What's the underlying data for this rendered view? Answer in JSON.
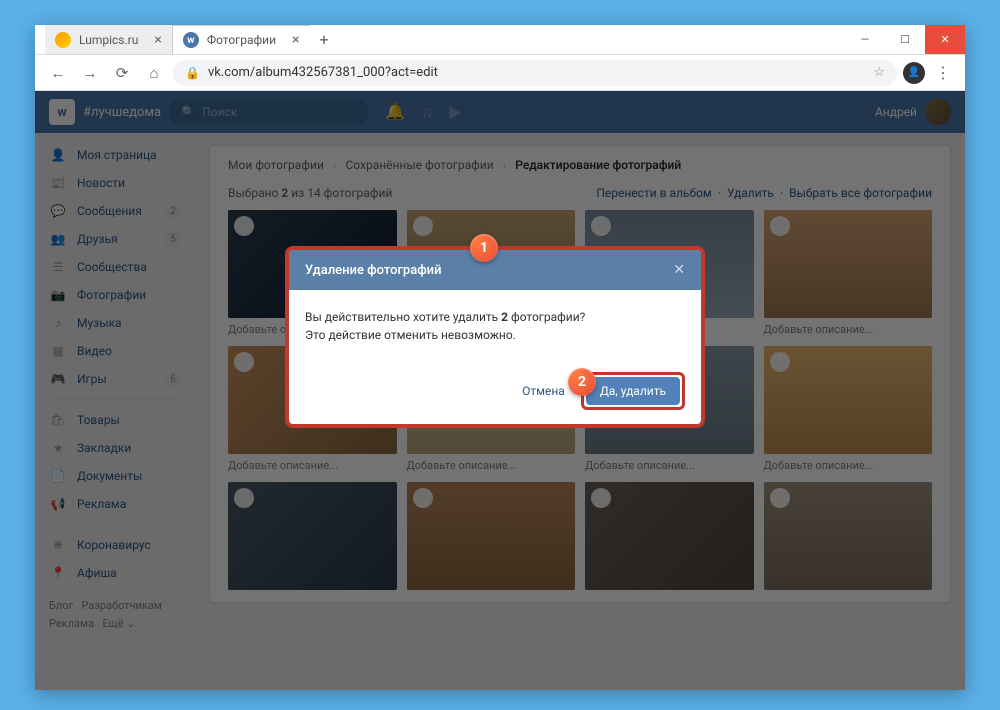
{
  "window": {
    "tabs": [
      {
        "title": "Lumpics.ru"
      },
      {
        "title": "Фотографии"
      }
    ],
    "newtab": "+",
    "controls": {
      "min": "—",
      "max": "☐",
      "close": "✕"
    }
  },
  "addr": {
    "back": "←",
    "fwd": "→",
    "reload": "⟳",
    "home": "⌂",
    "lock": "🔒",
    "url": "vk.com/album432567381_000?act=edit",
    "star": "☆",
    "menu": "⋮"
  },
  "vk": {
    "logo": "w",
    "hashtag": "#лучшедома",
    "search": "Поиск",
    "icons": {
      "bell": "🔔",
      "music": "♫",
      "video": "▶"
    },
    "user": "Андрей"
  },
  "nav": [
    {
      "icon": "👤",
      "label": "Моя страница",
      "badge": null
    },
    {
      "icon": "📰",
      "label": "Новости",
      "badge": null
    },
    {
      "icon": "💬",
      "label": "Сообщения",
      "badge": "2"
    },
    {
      "icon": "👥",
      "label": "Друзья",
      "badge": "5"
    },
    {
      "icon": "☰",
      "label": "Сообщества",
      "badge": null
    },
    {
      "icon": "📷",
      "label": "Фотографии",
      "badge": null
    },
    {
      "icon": "♪",
      "label": "Музыка",
      "badge": null
    },
    {
      "icon": "▦",
      "label": "Видео",
      "badge": null
    },
    {
      "icon": "🎮",
      "label": "Игры",
      "badge": "6"
    }
  ],
  "nav2": [
    {
      "icon": "🛍",
      "label": "Товары"
    },
    {
      "icon": "★",
      "label": "Закладки"
    },
    {
      "icon": "📄",
      "label": "Документы"
    },
    {
      "icon": "📢",
      "label": "Реклама"
    }
  ],
  "nav3": [
    {
      "icon": "❋",
      "label": "Коронавирус"
    },
    {
      "icon": "📍",
      "label": "Афиша"
    }
  ],
  "footer": {
    "l1": "Блог",
    "l2": "Разработчикам",
    "l3": "Реклама",
    "l4": "Ещё ⌄"
  },
  "breadcrumb": {
    "a": "Мои фотографии",
    "b": "Сохранённые фотографии",
    "c": "Редактирование фотографий"
  },
  "toolbar": {
    "selected_prefix": "Выбрано ",
    "selected_count": "2",
    "selected_suffix": " из 14 фотографий",
    "move": "Перенести в альбом",
    "del": "Удалить",
    "all": "Выбрать все фотографии"
  },
  "caption": "Добавьте описание...",
  "modal": {
    "title": "Удаление фотографий",
    "line1_a": "Вы действительно хотите удалить ",
    "line1_b": "2",
    "line1_c": " фотографии?",
    "line2": "Это действие отменить невозможно.",
    "cancel": "Отмена",
    "confirm": "Да, удалить",
    "close": "✕"
  },
  "callouts": {
    "c1": "1",
    "c2": "2"
  }
}
